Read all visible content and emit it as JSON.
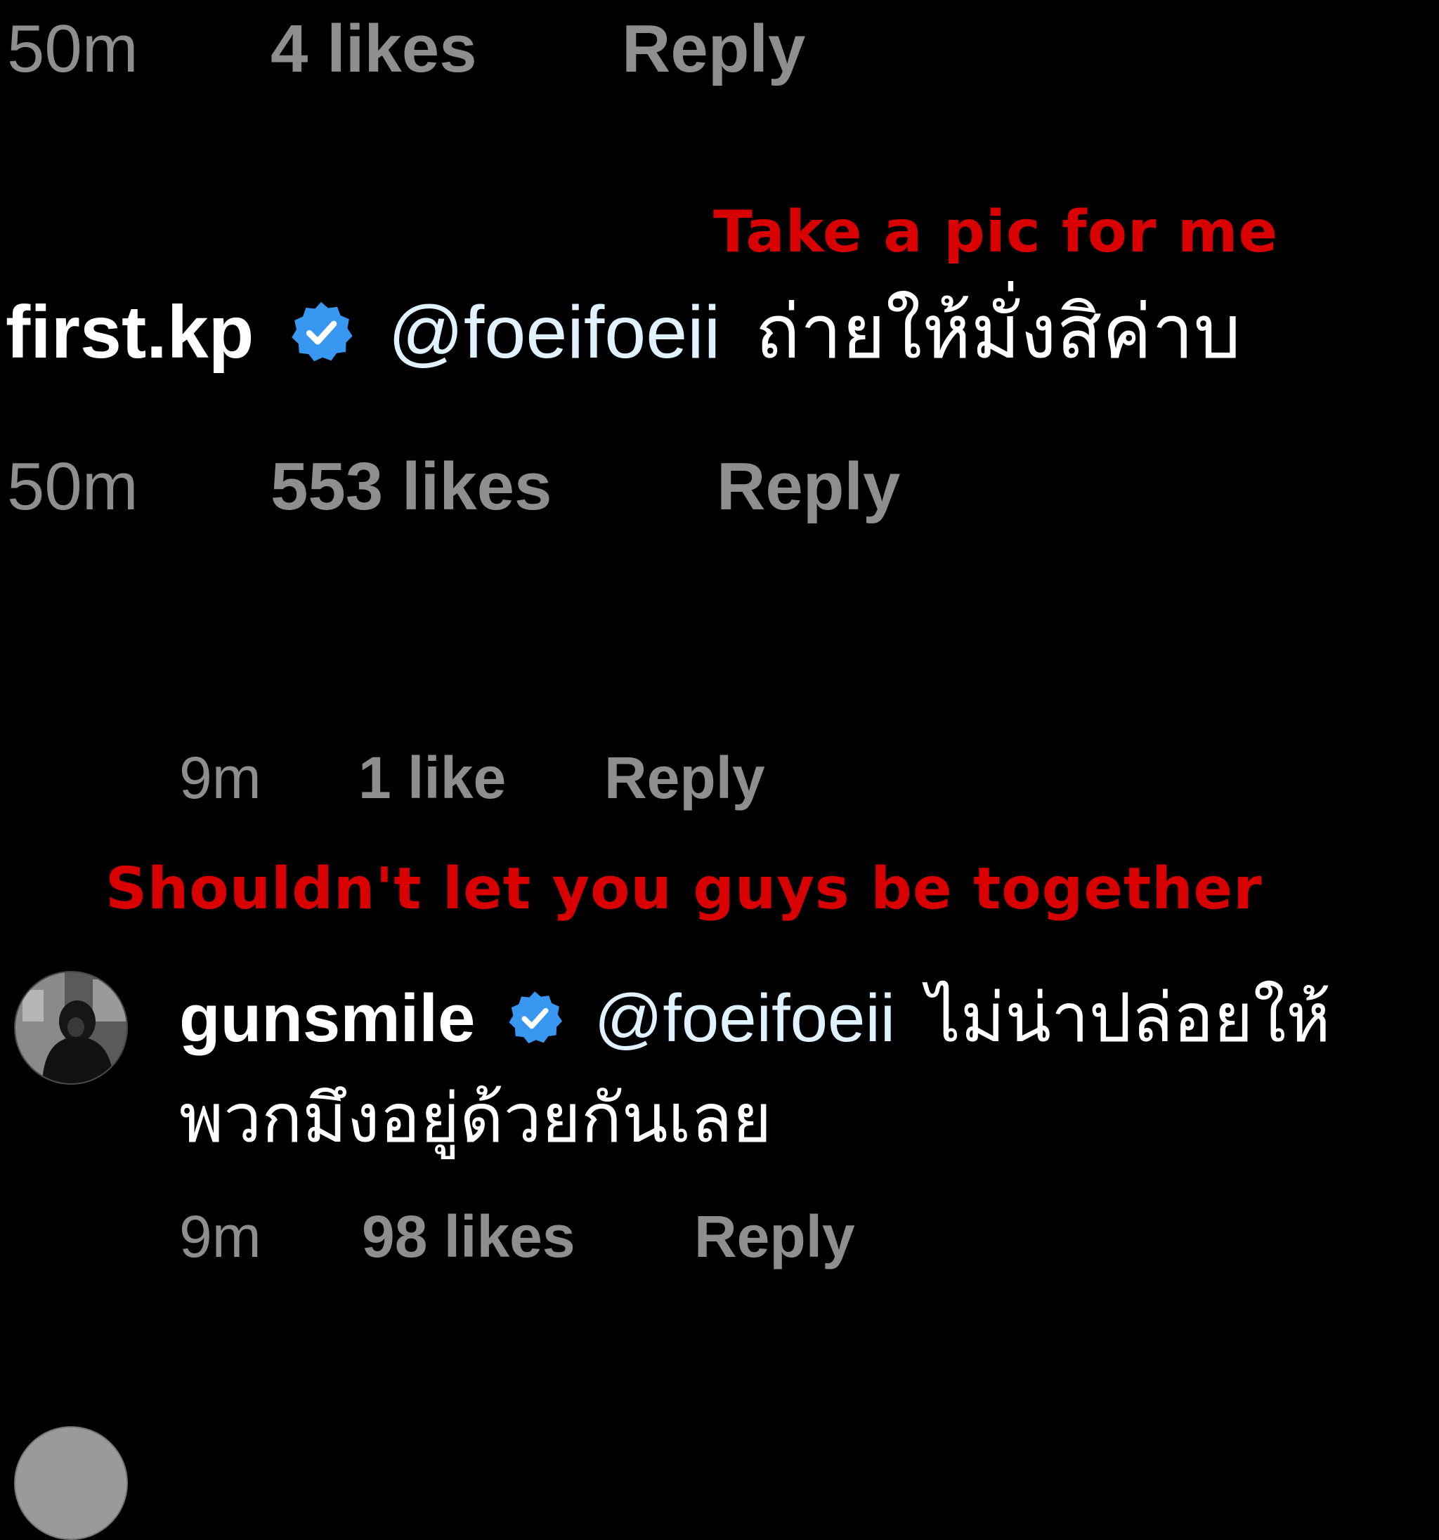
{
  "colors": {
    "background": "#000000",
    "meta_text": "#8e8e8e",
    "username": "#ffffff",
    "mention": "#e0f1ff",
    "verified_badge": "#3897f0",
    "caption_red": "#d80000"
  },
  "top_meta": {
    "time": "50m",
    "likes": "4 likes",
    "reply": "Reply"
  },
  "comment_first": {
    "caption": "Take a pic for me",
    "username": "first.kp",
    "verified_icon": "verified-badge-icon",
    "mention": "@foeifoeii",
    "text": "ถ่ายให้มั่งสิค่าบ",
    "time": "50m",
    "likes": "553 likes",
    "reply": "Reply"
  },
  "reply_meta": {
    "time": "9m",
    "likes": "1 like",
    "reply": "Reply"
  },
  "comment_gunsmile": {
    "caption": "Shouldn't let you guys be together",
    "username": "gunsmile",
    "verified_icon": "verified-badge-icon",
    "mention": "@foeifoeii",
    "text_line1": "ไม่น่าปล่อยให้",
    "text_line2": "พวกมึงอยู่ด้วยกันเลย",
    "time": "9m",
    "likes": "98 likes",
    "reply": "Reply"
  }
}
